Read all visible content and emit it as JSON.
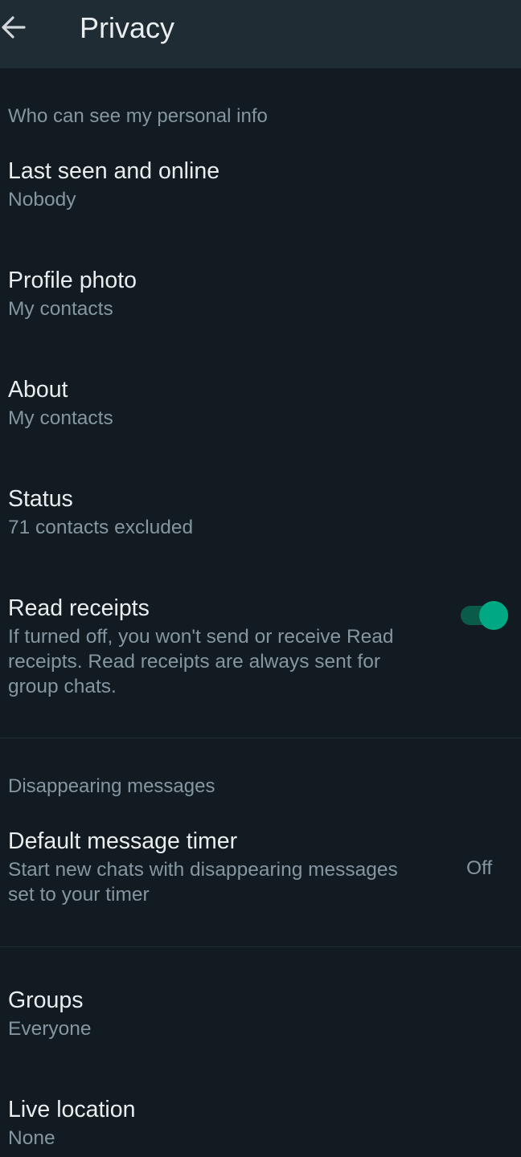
{
  "header": {
    "back_icon": "arrow-left-icon",
    "title": "Privacy"
  },
  "colors": {
    "background": "#111b21",
    "header_background": "#202c33",
    "primary_text": "#e9edef",
    "secondary_text": "#8696a0",
    "accent": "#00a884"
  },
  "personal_info": {
    "section_label": "Who can see my personal info",
    "last_seen": {
      "title": "Last seen and online",
      "value": "Nobody"
    },
    "profile_photo": {
      "title": "Profile photo",
      "value": "My contacts"
    },
    "about": {
      "title": "About",
      "value": "My contacts"
    },
    "status": {
      "title": "Status",
      "value": "71 contacts excluded"
    },
    "read_receipts": {
      "title": "Read receipts",
      "description": "If turned off, you won't send or receive Read receipts. Read receipts are always sent for group chats.",
      "enabled": true
    }
  },
  "disappearing": {
    "section_label": "Disappearing messages",
    "default_timer": {
      "title": "Default message timer",
      "description": "Start new chats with disappearing messages set to your timer",
      "value": "Off"
    }
  },
  "groups": {
    "title": "Groups",
    "value": "Everyone"
  },
  "live_location": {
    "title": "Live location",
    "value": "None"
  }
}
